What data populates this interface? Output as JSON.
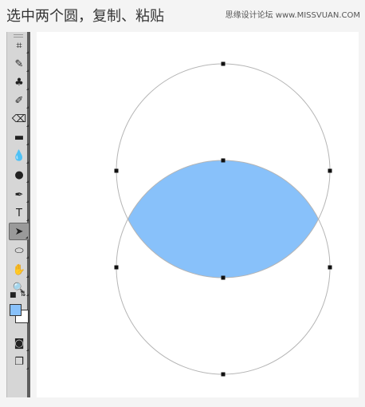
{
  "caption": "选中两个圆，复制、粘贴",
  "watermark": "思缘设计论坛  www.MISSVUAN.COM",
  "colors": {
    "selection_fill": "#88c1fa",
    "circle_stroke": "#b5b5b5",
    "foreground_swatch": "#88c1fa",
    "background_swatch": "#ffffff"
  },
  "toolbar": {
    "tools": [
      {
        "icon": "artboard-icon",
        "glyph": "⌗"
      },
      {
        "icon": "brush-icon",
        "glyph": "✎"
      },
      {
        "icon": "stamp-icon",
        "glyph": "♣"
      },
      {
        "icon": "history-brush-icon",
        "glyph": "✐"
      },
      {
        "icon": "eraser-icon",
        "glyph": "⌫"
      },
      {
        "icon": "gradient-icon",
        "glyph": "▬"
      },
      {
        "icon": "blur-icon",
        "glyph": "💧"
      },
      {
        "icon": "dodge-icon",
        "glyph": "●"
      },
      {
        "icon": "pen-icon",
        "glyph": "✒"
      },
      {
        "icon": "type-icon",
        "glyph": "T"
      },
      {
        "icon": "path-selection-icon",
        "glyph": "➤",
        "active": true
      },
      {
        "icon": "ellipse-icon",
        "glyph": "⬭"
      },
      {
        "icon": "hand-icon",
        "glyph": "✋"
      },
      {
        "icon": "zoom-icon",
        "glyph": "🔍"
      },
      {
        "icon": "quick-mask-icon",
        "glyph": "◙"
      },
      {
        "icon": "screen-mode-icon",
        "glyph": "❐"
      }
    ],
    "mini_icons": {
      "default_colors": "default-colors-icon",
      "swap_colors": "swap-colors-icon"
    }
  }
}
